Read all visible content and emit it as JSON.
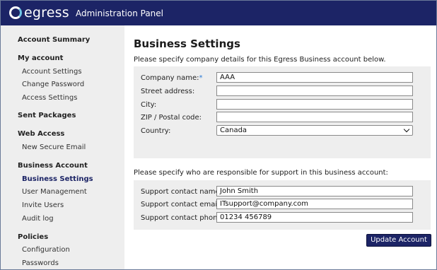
{
  "header": {
    "logo_text": "egress",
    "panel_title": "Administration Panel",
    "colors": {
      "bar": "#1c2466",
      "accent": "#6fc7e8"
    }
  },
  "sidebar": {
    "sections": [
      {
        "title": "Account Summary",
        "items": []
      },
      {
        "title": "My account",
        "items": [
          "Account Settings",
          "Change Password",
          "Access Settings"
        ]
      },
      {
        "title": "Sent Packages",
        "items": []
      },
      {
        "title": "Web Access",
        "items": [
          "New Secure Email"
        ]
      },
      {
        "title": "Business Account",
        "items": [
          "Business Settings",
          "User Management",
          "Invite Users",
          "Audit log"
        ]
      },
      {
        "title": "Policies",
        "items": [
          "Configuration",
          "Passwords"
        ]
      }
    ],
    "active_item": "Business Settings"
  },
  "main": {
    "title": "Business Settings",
    "intro": "Please specify company details for this Egress Business account below.",
    "company": {
      "name_label": "Company name:",
      "required_mark": "*",
      "name_value": "AAA",
      "street_label": "Street address:",
      "street_value": "",
      "city_label": "City:",
      "city_value": "",
      "zip_label": "ZIP / Postal code:",
      "zip_value": "",
      "country_label": "Country:",
      "country_value": "Canada"
    },
    "support_intro": "Please specify who are responsible for support in this business account:",
    "support": {
      "name_label": "Support contact name:",
      "name_value": "John Smith",
      "email_label": "Support contact email:",
      "email_value": "ITsupport@company.com",
      "phone_label": "Support contact phone:",
      "phone_value": "01234 456789"
    },
    "update_button": "Update Account"
  }
}
